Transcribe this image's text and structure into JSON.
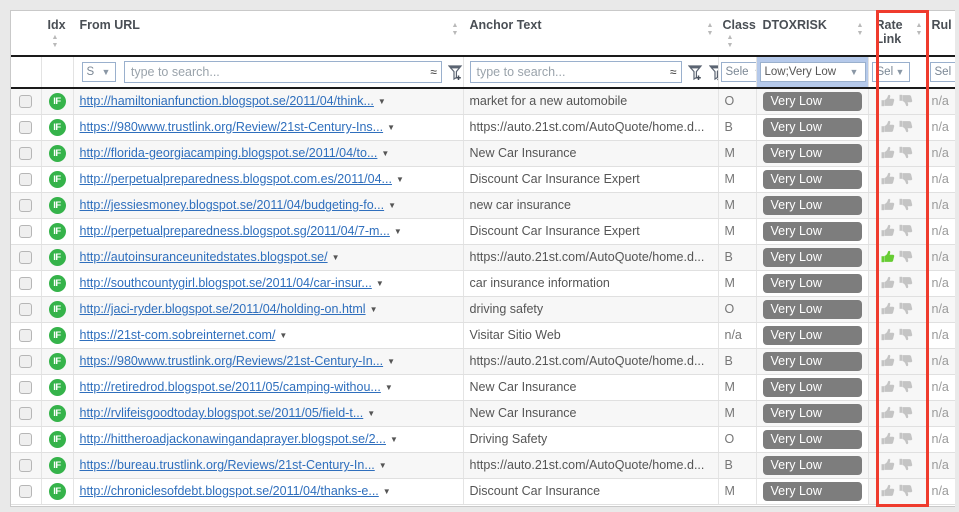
{
  "table": {
    "columns": [
      {
        "key": "check",
        "label": "",
        "sortable": false
      },
      {
        "key": "idx",
        "label": "Idx",
        "sortable": true
      },
      {
        "key": "url",
        "label": "From URL",
        "sortable": true
      },
      {
        "key": "anchor",
        "label": "Anchor Text",
        "sortable": true
      },
      {
        "key": "class",
        "label": "Class",
        "sortable": true
      },
      {
        "key": "dtox",
        "label": "DTOXRISK",
        "sortable": true
      },
      {
        "key": "rate",
        "label": "Rate Link",
        "sortable": true
      },
      {
        "key": "rule",
        "label": "Rul",
        "sortable": false
      }
    ],
    "filters": {
      "url_mode": "S",
      "url_search_placeholder": "type to search...",
      "url_approx_icon": "approximate-match-icon",
      "anchor_mode": "S",
      "anchor_search_placeholder": "type to search...",
      "anchor_approx_icon": "approximate-match-icon",
      "class_select": "Sele",
      "dtox_select": "Low;Very Low",
      "rate_select": "Sel",
      "rule_select": "Sel",
      "add_filter_icon": "funnel-add-icon",
      "clear_filter_icon": "funnel-clear-icon",
      "caret_icon": "chevron-down-icon"
    },
    "rows": [
      {
        "flag": "IF",
        "url": "http://hamiltonianfunction.blogspot.se/2011/04/think...",
        "anchor": "market for a new automobile",
        "class": "O",
        "dtox": "Very Low",
        "up": false,
        "rule": "n/a"
      },
      {
        "flag": "IF",
        "url": "https://980www.trustlink.org/Review/21st-Century-Ins...",
        "anchor": "https://auto.21st.com/AutoQuote/home.d...",
        "class": "B",
        "dtox": "Very Low",
        "up": false,
        "rule": "n/a"
      },
      {
        "flag": "IF",
        "url": "http://florida-georgiacamping.blogspot.se/2011/04/to...",
        "anchor": "New Car Insurance",
        "class": "M",
        "dtox": "Very Low",
        "up": false,
        "rule": "n/a"
      },
      {
        "flag": "IF",
        "url": "http://perpetualpreparedness.blogspot.com.es/2011/04...",
        "anchor": "Discount Car Insurance Expert",
        "class": "M",
        "dtox": "Very Low",
        "up": false,
        "rule": "n/a"
      },
      {
        "flag": "IF",
        "url": "http://jessiesmoney.blogspot.se/2011/04/budgeting-fo...",
        "anchor": "new car insurance",
        "class": "M",
        "dtox": "Very Low",
        "up": false,
        "rule": "n/a"
      },
      {
        "flag": "IF",
        "url": "http://perpetualpreparedness.blogspot.sg/2011/04/7-m...",
        "anchor": "Discount Car Insurance Expert",
        "class": "M",
        "dtox": "Very Low",
        "up": false,
        "rule": "n/a"
      },
      {
        "flag": "IF",
        "url": "http://autoinsuranceunitedstates.blogspot.se/",
        "anchor": "https://auto.21st.com/AutoQuote/home.d...",
        "class": "B",
        "dtox": "Very Low",
        "up": true,
        "rule": "n/a"
      },
      {
        "flag": "IF",
        "url": "http://southcountygirl.blogspot.se/2011/04/car-insur...",
        "anchor": "car insurance information",
        "class": "M",
        "dtox": "Very Low",
        "up": false,
        "rule": "n/a"
      },
      {
        "flag": "IF",
        "url": "http://jaci-ryder.blogspot.se/2011/04/holding-on.html",
        "anchor": "driving safety",
        "class": "O",
        "dtox": "Very Low",
        "up": false,
        "rule": "n/a"
      },
      {
        "flag": "IF",
        "url": "https://21st-com.sobreinternet.com/",
        "anchor": "Visitar Sitio Web",
        "class": "n/a",
        "dtox": "Very Low",
        "up": false,
        "rule": "n/a"
      },
      {
        "flag": "IF",
        "url": "https://980www.trustlink.org/Reviews/21st-Century-In...",
        "anchor": "https://auto.21st.com/AutoQuote/home.d...",
        "class": "B",
        "dtox": "Very Low",
        "up": false,
        "rule": "n/a"
      },
      {
        "flag": "IF",
        "url": "http://retiredrod.blogspot.se/2011/05/camping-withou...",
        "anchor": "New Car Insurance",
        "class": "M",
        "dtox": "Very Low",
        "up": false,
        "rule": "n/a"
      },
      {
        "flag": "IF",
        "url": "http://rvlifeisgoodtoday.blogspot.se/2011/05/field-t...",
        "anchor": "New Car Insurance",
        "class": "M",
        "dtox": "Very Low",
        "up": false,
        "rule": "n/a"
      },
      {
        "flag": "IF",
        "url": "http://hittheroadjackonawingandaprayer.blogspot.se/2...",
        "anchor": "Driving Safety",
        "class": "O",
        "dtox": "Very Low",
        "up": false,
        "rule": "n/a"
      },
      {
        "flag": "IF",
        "url": "https://bureau.trustlink.org/Reviews/21st-Century-In...",
        "anchor": "https://auto.21st.com/AutoQuote/home.d...",
        "class": "B",
        "dtox": "Very Low",
        "up": false,
        "rule": "n/a"
      },
      {
        "flag": "IF",
        "url": "http://chroniclesofdebt.blogspot.se/2011/04/thanks-e...",
        "anchor": "Discount Car Insurance",
        "class": "M",
        "dtox": "Very Low",
        "up": false,
        "rule": "n/a"
      }
    ]
  },
  "annotation": {
    "color": "#ef3b2d",
    "label": "rate-link-column-highlight"
  },
  "colors": {
    "link": "#2f6fbd",
    "badge_risk_bg": "#7d7d7d",
    "flag_green": "#35b34a",
    "thumb_up_active": "#66cc33",
    "thumb_idle": "#c4c4c4",
    "filter_highlight": "#b5c9ea"
  }
}
